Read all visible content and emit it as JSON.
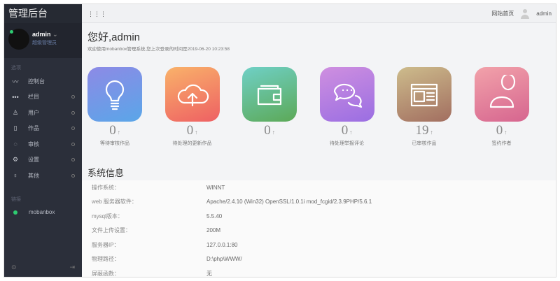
{
  "brand": "管理后台",
  "user": {
    "name": "admin",
    "role": "超级管理员",
    "caret": "⌄"
  },
  "sidebar": {
    "section1": "选项",
    "items": [
      {
        "label": "控制台",
        "icon": "chart-line-icon",
        "glyph": "〰"
      },
      {
        "label": "栏目",
        "icon": "dots-icon",
        "glyph": "•••"
      },
      {
        "label": "用户",
        "icon": "user-icon",
        "glyph": "♙"
      },
      {
        "label": "作品",
        "icon": "book-icon",
        "glyph": "▯"
      },
      {
        "label": "审核",
        "icon": "circle-icon",
        "glyph": "◌"
      },
      {
        "label": "设置",
        "icon": "gear-icon",
        "glyph": "⚙"
      },
      {
        "label": "其他",
        "icon": "bulb-icon",
        "glyph": "♀"
      }
    ],
    "section2": "链接",
    "link": "mobanbox",
    "bottom_left": "⊙",
    "bottom_right": "⇥"
  },
  "topbar": {
    "menu_glyph": "⋮⋮⋮",
    "home_link": "网站首页",
    "user": "admin"
  },
  "main": {
    "greeting": "您好,admin",
    "welcome": "欢迎使用mobanbox管理系统,您上次登录的时间是2019-06-20 10:23:58",
    "cards": [
      {
        "value": "0",
        "label": "等待审核作品",
        "color1": "#8d8ae6",
        "color2": "#5aa6e8",
        "icon": "lightbulb-icon"
      },
      {
        "value": "0",
        "label": "待处理的更新作品",
        "color1": "#f9b26a",
        "color2": "#ee6063",
        "icon": "cloud-upload-icon"
      },
      {
        "value": "0",
        "label": "",
        "color1": "#6fd0c6",
        "color2": "#5ca957",
        "icon": "wallet-icon"
      },
      {
        "value": "0",
        "label": "待处理举报评论",
        "color1": "#cf8fe0",
        "color2": "#9a6ee2",
        "icon": "chat-icon"
      },
      {
        "value": "19",
        "label": "已审核作品",
        "color1": "#cdbc8c",
        "color2": "#a26e60",
        "icon": "browser-icon"
      },
      {
        "value": "0",
        "label": "签约作者",
        "color1": "#f2a2aa",
        "color2": "#d6658f",
        "icon": "person-icon"
      }
    ],
    "arrow": "↑",
    "sys_title": "系统信息",
    "sys_info": [
      {
        "k": "操作系统：",
        "v": "WINNT"
      },
      {
        "k": "web 服务器软件：",
        "v": "Apache/2.4.10 (Win32) OpenSSL/1.0.1i mod_fcgid/2.3.9PHP/5.6.1"
      },
      {
        "k": "mysql版本：",
        "v": "5.5.40"
      },
      {
        "k": "文件上传设置：",
        "v": "200M"
      },
      {
        "k": "服务器IP：",
        "v": "127.0.0.1:80"
      },
      {
        "k": "物理路径：",
        "v": "D:\\php\\WWW/"
      },
      {
        "k": "屏蔽函数：",
        "v": "无"
      }
    ]
  }
}
